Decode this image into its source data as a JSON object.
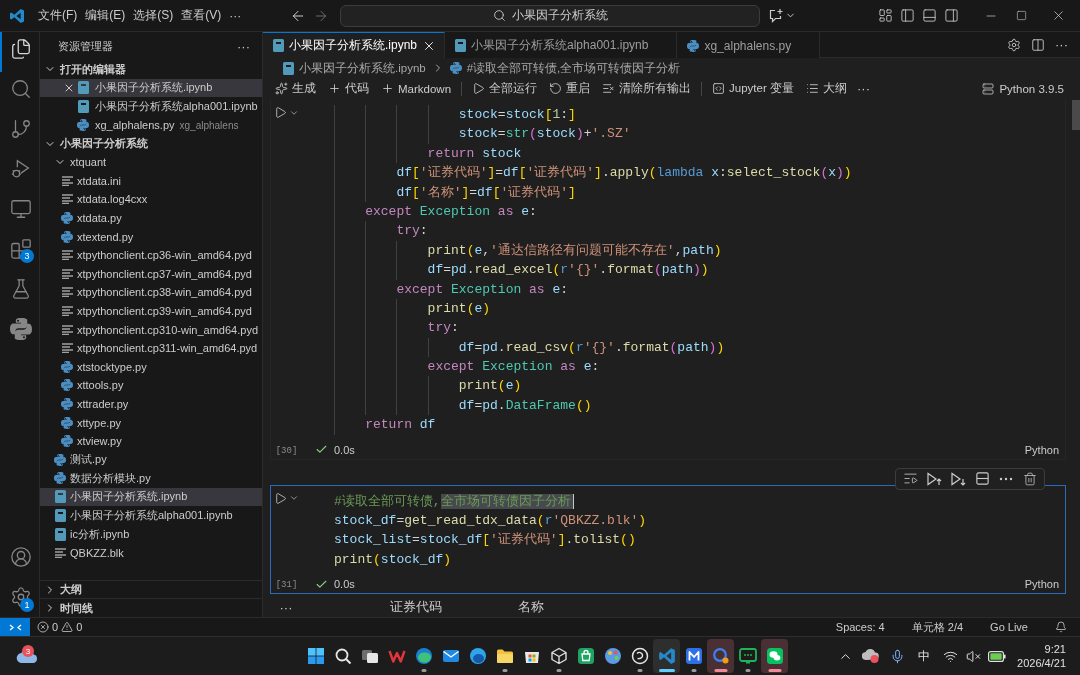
{
  "title_bar": {
    "menus": [
      "文件(F)",
      "编辑(E)",
      "选择(S)",
      "查看(V)"
    ],
    "more": "···",
    "search": "小果因子分析系统"
  },
  "activity_bar": {
    "top": [
      {
        "kind": "explorer",
        "selected": true
      },
      {
        "kind": "search",
        "selected": false
      },
      {
        "kind": "source_control",
        "selected": false
      },
      {
        "kind": "run_debug",
        "selected": false
      },
      {
        "kind": "remote",
        "selected": false
      },
      {
        "kind": "extensions",
        "selected": false,
        "badge": "3"
      },
      {
        "kind": "testing",
        "selected": false
      },
      {
        "kind": "python",
        "selected": false
      }
    ],
    "bottom": [
      {
        "kind": "account"
      },
      {
        "kind": "settings",
        "badge": "1"
      }
    ]
  },
  "sidebar": {
    "title": "资源管理器",
    "more": "···",
    "open_editors": {
      "label": "打开的编辑器",
      "expanded": true,
      "items": [
        {
          "name": "小果因子分析系统.ipynb",
          "kind": "notebook",
          "selected": true
        },
        {
          "name": "小果因子分析系统alpha001.ipynb",
          "kind": "notebook",
          "selected": false
        },
        {
          "name": "xg_alphalens.py",
          "kind": "python",
          "description": "xg_alphalens",
          "selected": false
        }
      ]
    },
    "folder": {
      "label": "小果因子分析系统",
      "expanded": true,
      "children": [
        {
          "name": "xtquant",
          "kind": "folder",
          "expanded": true,
          "selected": false,
          "children": [
            {
              "name": "xtdata.ini",
              "kind": "text",
              "selected": false
            },
            {
              "name": "xtdata.log4cxx",
              "kind": "text",
              "selected": false
            },
            {
              "name": "xtdata.py",
              "kind": "python",
              "selected": false
            },
            {
              "name": "xtextend.py",
              "kind": "python",
              "selected": false
            },
            {
              "name": "xtpythonclient.cp36-win_amd64.pyd",
              "kind": "text",
              "selected": false
            },
            {
              "name": "xtpythonclient.cp37-win_amd64.pyd",
              "kind": "text",
              "selected": false
            },
            {
              "name": "xtpythonclient.cp38-win_amd64.pyd",
              "kind": "text",
              "selected": false
            },
            {
              "name": "xtpythonclient.cp39-win_amd64.pyd",
              "kind": "text",
              "selected": false
            },
            {
              "name": "xtpythonclient.cp310-win_amd64.pyd",
              "kind": "text",
              "selected": false
            },
            {
              "name": "xtpythonclient.cp311-win_amd64.pyd",
              "kind": "text",
              "selected": false
            },
            {
              "name": "xtstocktype.py",
              "kind": "python",
              "selected": false
            },
            {
              "name": "xttools.py",
              "kind": "python",
              "selected": false
            },
            {
              "name": "xttrader.py",
              "kind": "python",
              "selected": false
            },
            {
              "name": "xttype.py",
              "kind": "python",
              "selected": false
            },
            {
              "name": "xtview.py",
              "kind": "python",
              "selected": false
            }
          ]
        },
        {
          "name": "测试.py",
          "kind": "python",
          "selected": false
        },
        {
          "name": "数据分析模块.py",
          "kind": "python",
          "selected": false
        },
        {
          "name": "小果因子分析系统.ipynb",
          "kind": "notebook",
          "selected": true
        },
        {
          "name": "小果因子分析系统alpha001.ipynb",
          "kind": "notebook",
          "selected": false
        },
        {
          "name": "ic分析.ipynb",
          "kind": "notebook",
          "selected": false
        },
        {
          "name": "QBKZZ.blk",
          "kind": "text",
          "selected": false
        }
      ]
    },
    "sections": [
      {
        "label": "大纲",
        "expanded": false
      },
      {
        "label": "时间线",
        "expanded": false
      }
    ]
  },
  "editor": {
    "tabs": [
      {
        "label": "小果因子分析系统.ipynb",
        "kind": "notebook",
        "selected": true
      },
      {
        "label": "小果因子分析系统alpha001.ipynb",
        "kind": "notebook",
        "selected": false
      },
      {
        "label": "xg_alphalens.py",
        "kind": "python",
        "selected": false
      }
    ],
    "actions_more": "···",
    "breadcrumbs": [
      {
        "kind": "notebook",
        "label": "小果因子分析系统.ipynb"
      },
      {
        "kind": "python",
        "label": "#读取全部可转债,全市场可转债因子分析"
      }
    ],
    "toolbar": {
      "groups": [
        [
          {
            "kind": "sparkle",
            "label": "生成"
          },
          {
            "kind": "plus",
            "label": "代码"
          },
          {
            "kind": "plus",
            "label": "Markdown"
          }
        ],
        [
          {
            "kind": "run_all",
            "label": "全部运行"
          },
          {
            "kind": "restart",
            "label": "重启"
          },
          {
            "kind": "clear",
            "label": "清除所有输出"
          }
        ],
        [
          {
            "kind": "variables",
            "label": "Jupyter 变量"
          },
          {
            "kind": "outline",
            "label": "大纲"
          }
        ]
      ],
      "more": "···",
      "kernel": "Python 3.9.5"
    },
    "cells": [
      {
        "execution_count": "[30]",
        "time": "0.0s",
        "language": "Python",
        "focused": false,
        "lines": [
          {
            "tokens": [
              {
                "kind": "var",
                "text": "                stock"
              },
              {
                "kind": "op",
                "text": "="
              },
              {
                "kind": "var",
                "text": "stock"
              },
              {
                "kind": "b1",
                "text": "["
              },
              {
                "kind": "num",
                "text": "1"
              },
              {
                "kind": "op",
                "text": ":"
              },
              {
                "kind": "b1",
                "text": "]"
              }
            ]
          },
          {
            "tokens": [
              {
                "kind": "var",
                "text": "                stock"
              },
              {
                "kind": "op",
                "text": "="
              },
              {
                "kind": "cls",
                "text": "str"
              },
              {
                "kind": "b2",
                "text": "("
              },
              {
                "kind": "var",
                "text": "stock"
              },
              {
                "kind": "b2",
                "text": ")"
              },
              {
                "kind": "op",
                "text": "+"
              },
              {
                "kind": "str",
                "text": "'.SZ'"
              }
            ]
          },
          {
            "tokens": [
              {
                "kind": "kw",
                "text": "            return"
              },
              {
                "kind": "var",
                "text": " stock"
              }
            ]
          },
          {
            "tokens": [
              {
                "kind": "var",
                "text": "        df"
              },
              {
                "kind": "b1",
                "text": "["
              },
              {
                "kind": "str",
                "text": "'证券代码'"
              },
              {
                "kind": "b1",
                "text": "]"
              },
              {
                "kind": "op",
                "text": "="
              },
              {
                "kind": "var",
                "text": "df"
              },
              {
                "kind": "b1",
                "text": "["
              },
              {
                "kind": "str",
                "text": "'证券代码'"
              },
              {
                "kind": "b1",
                "text": "]"
              },
              {
                "kind": "op",
                "text": "."
              },
              {
                "kind": "fn",
                "text": "apply"
              },
              {
                "kind": "b1",
                "text": "("
              },
              {
                "kind": "storage",
                "text": "lambda"
              },
              {
                "kind": "var",
                "text": " x"
              },
              {
                "kind": "op",
                "text": ":"
              },
              {
                "kind": "fn",
                "text": "select_stock"
              },
              {
                "kind": "b2",
                "text": "("
              },
              {
                "kind": "var",
                "text": "x"
              },
              {
                "kind": "b2",
                "text": ")"
              },
              {
                "kind": "b1",
                "text": ")"
              }
            ]
          },
          {
            "tokens": [
              {
                "kind": "var",
                "text": "        df"
              },
              {
                "kind": "b1",
                "text": "["
              },
              {
                "kind": "str",
                "text": "'名称'"
              },
              {
                "kind": "b1",
                "text": "]"
              },
              {
                "kind": "op",
                "text": "="
              },
              {
                "kind": "var",
                "text": "df"
              },
              {
                "kind": "b1",
                "text": "["
              },
              {
                "kind": "str",
                "text": "'证券代码'"
              },
              {
                "kind": "b1",
                "text": "]"
              }
            ]
          },
          {
            "tokens": [
              {
                "kind": "kw",
                "text": "    except"
              },
              {
                "kind": "cls",
                "text": " Exception"
              },
              {
                "kind": "kw",
                "text": " as"
              },
              {
                "kind": "var",
                "text": " e"
              },
              {
                "kind": "op",
                "text": ":"
              }
            ]
          },
          {
            "tokens": [
              {
                "kind": "kw",
                "text": "        try"
              },
              {
                "kind": "op",
                "text": ":"
              }
            ]
          },
          {
            "tokens": [
              {
                "kind": "fn",
                "text": "            print"
              },
              {
                "kind": "b1",
                "text": "("
              },
              {
                "kind": "var",
                "text": "e"
              },
              {
                "kind": "op",
                "text": ","
              },
              {
                "kind": "str",
                "text": "'通达信路径有问题可能不存在'"
              },
              {
                "kind": "op",
                "text": ","
              },
              {
                "kind": "var",
                "text": "path"
              },
              {
                "kind": "b1",
                "text": ")"
              }
            ]
          },
          {
            "tokens": [
              {
                "kind": "var",
                "text": "            df"
              },
              {
                "kind": "op",
                "text": "="
              },
              {
                "kind": "var",
                "text": "pd"
              },
              {
                "kind": "op",
                "text": "."
              },
              {
                "kind": "fn",
                "text": "read_excel"
              },
              {
                "kind": "b1",
                "text": "("
              },
              {
                "kind": "storage",
                "text": "r"
              },
              {
                "kind": "str",
                "text": "'{}'"
              },
              {
                "kind": "op",
                "text": "."
              },
              {
                "kind": "fn",
                "text": "format"
              },
              {
                "kind": "b2",
                "text": "("
              },
              {
                "kind": "var",
                "text": "path"
              },
              {
                "kind": "b2",
                "text": ")"
              },
              {
                "kind": "b1",
                "text": ")"
              }
            ]
          },
          {
            "tokens": [
              {
                "kind": "kw",
                "text": "        except"
              },
              {
                "kind": "cls",
                "text": " Exception"
              },
              {
                "kind": "kw",
                "text": " as"
              },
              {
                "kind": "var",
                "text": " e"
              },
              {
                "kind": "op",
                "text": ":"
              }
            ]
          },
          {
            "tokens": [
              {
                "kind": "fn",
                "text": "            print"
              },
              {
                "kind": "b1",
                "text": "("
              },
              {
                "kind": "var",
                "text": "e"
              },
              {
                "kind": "b1",
                "text": ")"
              }
            ]
          },
          {
            "tokens": [
              {
                "kind": "kw",
                "text": "            try"
              },
              {
                "kind": "op",
                "text": ":"
              }
            ]
          },
          {
            "tokens": [
              {
                "kind": "var",
                "text": "                df"
              },
              {
                "kind": "op",
                "text": "="
              },
              {
                "kind": "var",
                "text": "pd"
              },
              {
                "kind": "op",
                "text": "."
              },
              {
                "kind": "fn",
                "text": "read_csv"
              },
              {
                "kind": "b1",
                "text": "("
              },
              {
                "kind": "storage",
                "text": "r"
              },
              {
                "kind": "str",
                "text": "'{}'"
              },
              {
                "kind": "op",
                "text": "."
              },
              {
                "kind": "fn",
                "text": "format"
              },
              {
                "kind": "b2",
                "text": "("
              },
              {
                "kind": "var",
                "text": "path"
              },
              {
                "kind": "b2",
                "text": ")"
              },
              {
                "kind": "b1",
                "text": ")"
              }
            ]
          },
          {
            "tokens": [
              {
                "kind": "kw",
                "text": "            except"
              },
              {
                "kind": "cls",
                "text": " Exception"
              },
              {
                "kind": "kw",
                "text": " as"
              },
              {
                "kind": "var",
                "text": " e"
              },
              {
                "kind": "op",
                "text": ":"
              }
            ]
          },
          {
            "tokens": [
              {
                "kind": "fn",
                "text": "                print"
              },
              {
                "kind": "b1",
                "text": "("
              },
              {
                "kind": "var",
                "text": "e"
              },
              {
                "kind": "b1",
                "text": ")"
              }
            ]
          },
          {
            "tokens": [
              {
                "kind": "var",
                "text": "                df"
              },
              {
                "kind": "op",
                "text": "="
              },
              {
                "kind": "var",
                "text": "pd"
              },
              {
                "kind": "op",
                "text": "."
              },
              {
                "kind": "cls",
                "text": "DataFrame"
              },
              {
                "kind": "b1",
                "text": "("
              },
              {
                "kind": "b1",
                "text": ")"
              }
            ]
          },
          {
            "tokens": [
              {
                "kind": "kw",
                "text": "    return"
              },
              {
                "kind": "var",
                "text": " df"
              }
            ]
          }
        ]
      },
      {
        "execution_count": "[31]",
        "time": "0.0s",
        "language": "Python",
        "focused": true,
        "lines": [
          {
            "tokens": [
              {
                "kind": "comment",
                "text": "#读取全部可转债,"
              },
              {
                "kind": "selected_comment",
                "text": "全市场可转债因子分析"
              }
            ]
          },
          {
            "tokens": [
              {
                "kind": "var",
                "text": "stock_df"
              },
              {
                "kind": "op",
                "text": "="
              },
              {
                "kind": "fn",
                "text": "get_read_tdx_data"
              },
              {
                "kind": "b1",
                "text": "("
              },
              {
                "kind": "storage",
                "text": "r"
              },
              {
                "kind": "str",
                "text": "'QBKZZ.blk'"
              },
              {
                "kind": "b1",
                "text": ")"
              }
            ]
          },
          {
            "tokens": [
              {
                "kind": "var",
                "text": "stock_list"
              },
              {
                "kind": "op",
                "text": "="
              },
              {
                "kind": "var",
                "text": "stock_df"
              },
              {
                "kind": "b1",
                "text": "["
              },
              {
                "kind": "str",
                "text": "'证券代码'"
              },
              {
                "kind": "b1",
                "text": "]"
              },
              {
                "kind": "op",
                "text": "."
              },
              {
                "kind": "fn",
                "text": "tolist"
              },
              {
                "kind": "b1",
                "text": "("
              },
              {
                "kind": "b1",
                "text": ")"
              }
            ]
          },
          {
            "tokens": [
              {
                "kind": "fn",
                "text": "print"
              },
              {
                "kind": "b1",
                "text": "("
              },
              {
                "kind": "var",
                "text": "stock_df"
              },
              {
                "kind": "b1",
                "text": ")"
              }
            ]
          }
        ]
      }
    ],
    "output": {
      "more": "···",
      "columns": [
        "证券代码",
        "名称"
      ]
    }
  },
  "status_bar": {
    "errors": "0",
    "warnings": "0",
    "items": [
      "Spaces: 4",
      "单元格 2/4",
      "Go Live"
    ]
  },
  "taskbar": {
    "weather_badge": "3",
    "apps": [
      {
        "kind": "start",
        "running": false,
        "selected": false,
        "attention": false
      },
      {
        "kind": "search",
        "running": false,
        "selected": false,
        "attention": false
      },
      {
        "kind": "task_view",
        "running": false,
        "selected": false,
        "attention": false
      },
      {
        "kind": "w_logo",
        "running": false,
        "selected": false,
        "attention": false
      },
      {
        "kind": "browser",
        "running": true,
        "selected": false,
        "attention": false
      },
      {
        "kind": "mail",
        "running": false,
        "selected": false,
        "attention": false
      },
      {
        "kind": "browser_alt",
        "running": false,
        "selected": false,
        "attention": false
      },
      {
        "kind": "folder",
        "running": true,
        "selected": false,
        "attention": false
      },
      {
        "kind": "store",
        "running": false,
        "selected": false,
        "attention": false
      },
      {
        "kind": "cube",
        "running": true,
        "selected": false,
        "attention": false
      },
      {
        "kind": "bag",
        "running": false,
        "selected": false,
        "attention": false
      },
      {
        "kind": "palette",
        "running": false,
        "selected": false,
        "attention": false
      },
      {
        "kind": "knot",
        "running": true,
        "selected": false,
        "attention": false
      },
      {
        "kind": "code",
        "running": true,
        "selected": true,
        "attention": false
      },
      {
        "kind": "m_logo",
        "running": true,
        "selected": false,
        "attention": false
      },
      {
        "kind": "magnifier",
        "running": true,
        "selected": false,
        "attention": true
      },
      {
        "kind": "chat_screen",
        "running": true,
        "selected": false,
        "attention": false
      },
      {
        "kind": "chat_bubbles",
        "running": true,
        "selected": false,
        "attention": true
      }
    ],
    "tray": {
      "ime": "中",
      "time": "9:21",
      "date": "2026/4/21"
    }
  }
}
